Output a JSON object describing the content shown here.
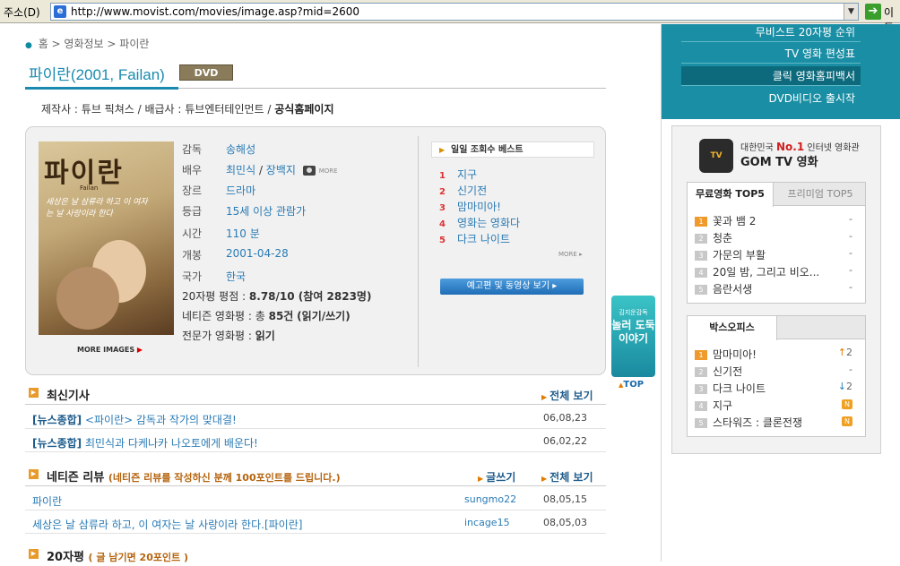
{
  "browser": {
    "address_label": "주소(D)",
    "url": "http://www.movist.com/movies/image.asp?mid=2600",
    "go_label": "이동"
  },
  "breadcrumb": [
    "홈",
    "영화정보",
    "파이란"
  ],
  "title": {
    "text": "파이란(2001, Failan)",
    "badge": "DVD"
  },
  "company": {
    "text": "제작사 : 튜브 픽쳐스 / 배급사 : 튜브엔터테인먼트 / ",
    "homepage": "공식홈페이지"
  },
  "poster": {
    "title": "파이란",
    "subtitle": "Failan",
    "tagline": "세상은 날 삼류라 하고 이 여자는 날 사랑이라 한다",
    "more_images": "MORE IMAGES"
  },
  "info": {
    "director": {
      "label": "감독",
      "value": "송해성"
    },
    "cast": {
      "label": "배우",
      "value1": "최민식",
      "sep": " / ",
      "value2": "장백지",
      "more": "MORE"
    },
    "genre": {
      "label": "장르",
      "value": "드라마"
    },
    "rating": {
      "label": "등급",
      "value": "15세 이상 관람가"
    },
    "runtime": {
      "label": "시간",
      "value": "110 분"
    },
    "release": {
      "label": "개봉",
      "value": "2001-04-28"
    },
    "country": {
      "label": "국가",
      "value": "한국"
    },
    "score": {
      "text": "20자평 평점 : ",
      "value": "8.78/10 (참여 2823명)"
    },
    "netizen": {
      "text": "네티즌 영화평 : 총 ",
      "count": "85건",
      "read_write": "(읽기/쓰기)"
    },
    "expert": {
      "text": "전문가 영화평 : ",
      "read": "읽기"
    }
  },
  "daily_best": {
    "title": "일일 조회수 베스트",
    "items": [
      {
        "num": "1",
        "name": "지구"
      },
      {
        "num": "2",
        "name": "신기전"
      },
      {
        "num": "3",
        "name": "맘마미아!"
      },
      {
        "num": "4",
        "name": "영화는 영화다"
      },
      {
        "num": "5",
        "name": "다크 나이트"
      }
    ],
    "more": "MORE",
    "trailer_button": "예고편 및 동영상 보기"
  },
  "news": {
    "title": "최신기사",
    "view_all": "전체 보기",
    "items": [
      {
        "tag": "[뉴스종합]",
        "title": " <파이란> 감독과 작가의 맞대결!",
        "date": "06,08,23"
      },
      {
        "tag": "[뉴스종합]",
        "title": " 최민식과 다케나카 나오토에게 배운다!",
        "date": "06,02,22"
      }
    ]
  },
  "reviews": {
    "title": "네티즌 리뷰",
    "promo": "(네티즌 리뷰를 작성하신 분께 100포인트를 드립니다.)",
    "write": "글쓰기",
    "view_all": "전체 보기",
    "items": [
      {
        "title": "파이란",
        "user": "sungmo22",
        "date": "08,05,15"
      },
      {
        "title": "세상은 날 삼류라 하고, 이 여자는 날 사랑이라 한다.[파이란]",
        "user": "incage15",
        "date": "08,05,03"
      }
    ]
  },
  "short_reviews": {
    "title": "20자평",
    "promo": "( 글 남기면 20포인트 )"
  },
  "side_banner": {
    "small": "김지운감독",
    "big": "놀러 도둑 이야기"
  },
  "top_link": "TOP",
  "right_menu": [
    "무비스트 20자평 순위",
    "TV 영화 편성표",
    "클릭 영화홈피백서",
    "DVD비디오 출시작"
  ],
  "gom": {
    "tagline_pre": "대한민국 ",
    "no1": "No.1",
    "tagline_post": " 인터넷 영화관",
    "logo": "TV",
    "name": "GOM TV 영화"
  },
  "free_movies": {
    "tab_on": "무료영화 TOP5",
    "tab_off": "프리미엄 TOP5",
    "items": [
      {
        "rank": "1",
        "name": "꽃과 뱀 2",
        "change": "-"
      },
      {
        "rank": "2",
        "name": "청춘",
        "change": "-"
      },
      {
        "rank": "3",
        "name": "가문의 부활",
        "change": "-"
      },
      {
        "rank": "4",
        "name": "20일 밤, 그리고 비오...",
        "change": "-"
      },
      {
        "rank": "5",
        "name": "음란서생",
        "change": "-"
      }
    ]
  },
  "box_office": {
    "title": "박스오피스",
    "items": [
      {
        "rank": "1",
        "name": "맘마미아!",
        "change": "2"
      },
      {
        "rank": "2",
        "name": "신기전",
        "change": "-"
      },
      {
        "rank": "3",
        "name": "다크 나이트",
        "change": "2"
      },
      {
        "rank": "4",
        "name": "지구",
        "change": "N"
      },
      {
        "rank": "5",
        "name": "스타워즈 : 클론전쟁",
        "change": "N"
      }
    ]
  }
}
